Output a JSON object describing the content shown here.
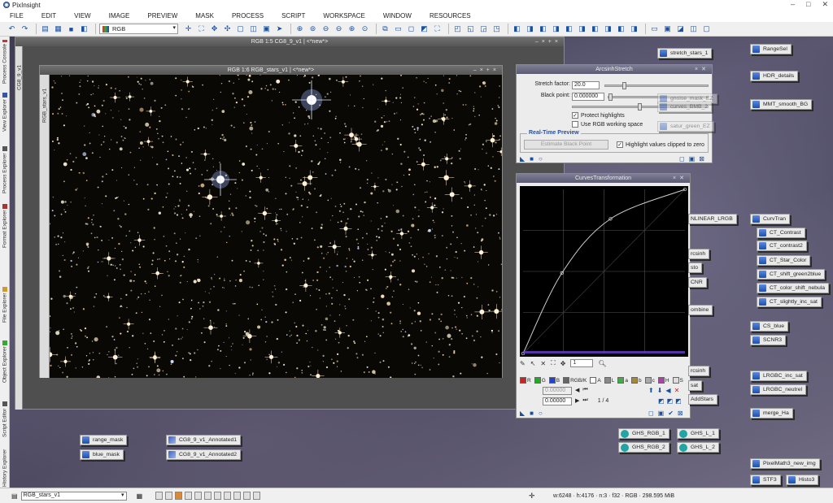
{
  "app": {
    "title": "PixInsight"
  },
  "menu": [
    "FILE",
    "EDIT",
    "VIEW",
    "IMAGE",
    "PREVIEW",
    "MASK",
    "PROCESS",
    "SCRIPT",
    "WORKSPACE",
    "WINDOW",
    "RESOURCES"
  ],
  "toolbar": {
    "view_selector": "RGB"
  },
  "left_dock": [
    "Process Console",
    "View Explorer",
    "Process Explorer",
    "Format Explorer",
    "File Explorer",
    "Object Explorer",
    "Script Editor",
    "History Explorer"
  ],
  "windows": {
    "back": {
      "title": "RGB 1:5 CG8_9_v1 | <*new*>",
      "side_tab": "CG8_9_v1"
    },
    "front": {
      "title": "RGB 1:6 RGB_stars_v1 | <*new*>",
      "side_tab": "RGB_stars_v1"
    }
  },
  "arcsinh": {
    "title": "ArcsinhStretch",
    "stretch_label": "Stretch factor:",
    "stretch_value": "20.0",
    "stretch_fraction": 0.17,
    "black_label": "Black point:",
    "black_value": "0.000000",
    "black_fraction": 0.0,
    "protect_label": "Protect highlights",
    "protect_checked": true,
    "rgbws_label": "Use RGB working space",
    "rgbws_checked": false,
    "rtp_label": "Real-Time Preview",
    "estimate_button": "Estimate Black Point",
    "clipped_label": "Highlight values clipped to zero",
    "clipped_checked": true
  },
  "curves": {
    "title": "CurvesTransformation",
    "channels": [
      {
        "label": "R",
        "color": "#cc2222"
      },
      {
        "label": "G",
        "color": "#22aa22"
      },
      {
        "label": "B",
        "color": "#2244cc"
      },
      {
        "label": "RGB/K",
        "color": "#666666"
      },
      {
        "label": "A",
        "color": "#ffffff"
      },
      {
        "label": "L",
        "color": "#888888"
      },
      {
        "label": "a",
        "color": "#44aa44"
      },
      {
        "label": "b",
        "color": "#aa8833"
      },
      {
        "label": "c",
        "color": "#aaaaaa"
      },
      {
        "label": "H",
        "color": "#aa44aa"
      },
      {
        "label": "S",
        "color": "#dddddd"
      }
    ],
    "zoom": "1",
    "input_label": "Input:",
    "input_value": "0.00000",
    "output_label": "Output:",
    "output_value": "0.00000",
    "point_counter": "1 / 4",
    "curve_points": [
      [
        0,
        0
      ],
      [
        0.24,
        0.49
      ],
      [
        0.54,
        0.82
      ],
      [
        1,
        1
      ]
    ]
  },
  "icons_top": [
    "stretch_stars_1"
  ],
  "icons_ghost": [
    "gnoise_mask_EZ",
    "curves_BMB_2",
    "satur_green_EZ"
  ],
  "icons_right": [
    "RangeSel",
    "HDR_details",
    "MMT_smooth_BG",
    "CurvTran",
    "CT_Contrast",
    "CT_contrast2",
    "CT_Star_Color",
    "CT_shift_green2blue",
    "CT_color_shift_nebula",
    "CT_slightly_inc_sat",
    "CS_blue",
    "SCNR3",
    "LRGBC_inc_sat",
    "LRGBC_neutrel",
    "merge_Ha",
    "PixelMath3_new_img",
    "STF3",
    "Histo3"
  ],
  "icons_mid": [
    "NLINEAR_LRGB",
    "rcsinh",
    "sto",
    "CNR",
    "ombine",
    "rcsinh",
    "sat",
    "AddStars"
  ],
  "icons_ghs": [
    "GHS_RGB_1",
    "GHS_L_1",
    "GHS_RGB_2",
    "GHS_L_2"
  ],
  "icons_bottom": [
    "range_mask",
    "blue_mask",
    "CG8_9_v1_Annotated1",
    "CG8_9_v1_Annotated2"
  ],
  "status": {
    "view": "RGB_stars_v1",
    "info": "w:6248 · h:4176 · n:3 · f32 · RGB · 298.595 MiB"
  }
}
